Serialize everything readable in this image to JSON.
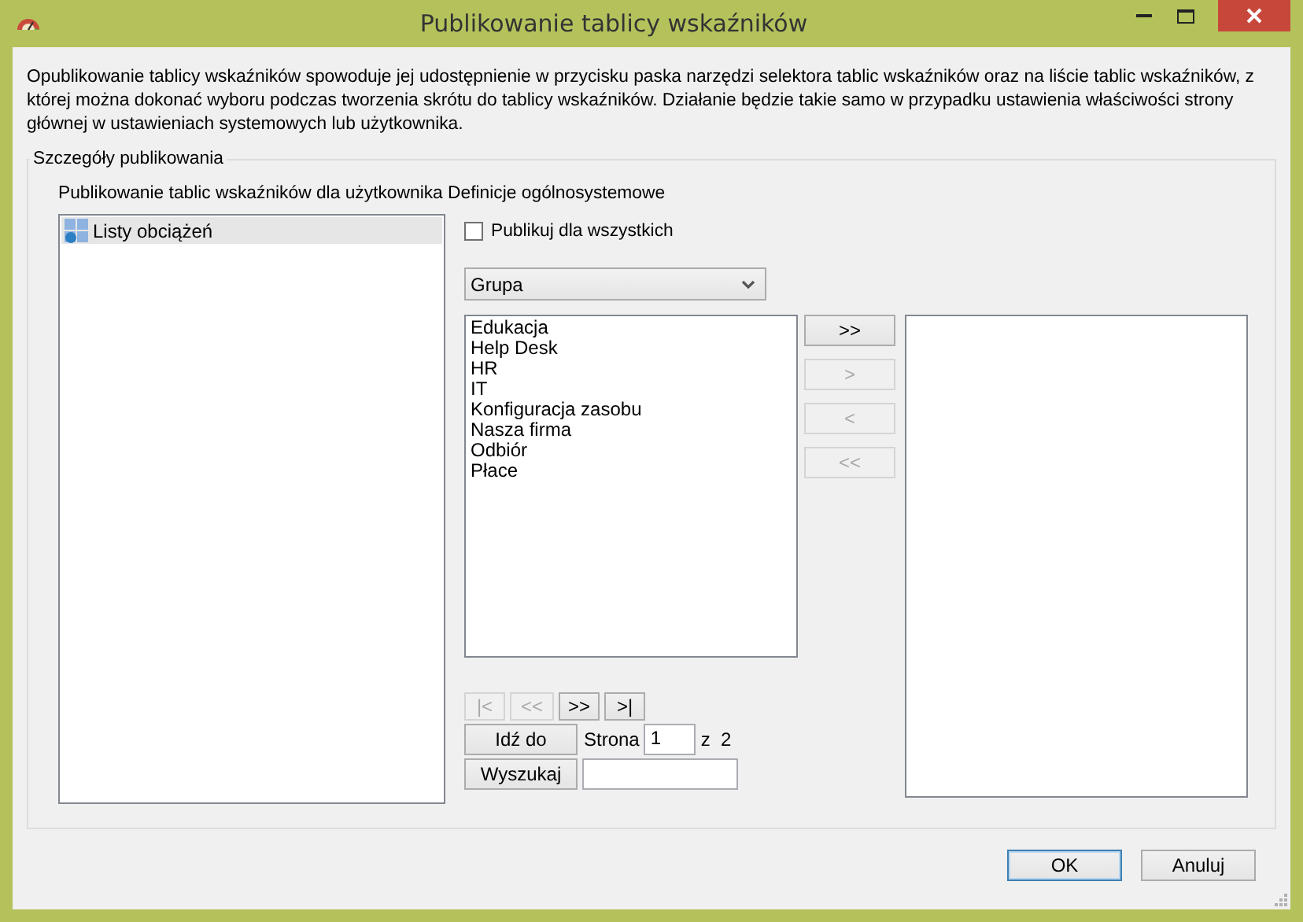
{
  "window": {
    "title": "Publikowanie tablicy wskaźników"
  },
  "description": "Opublikowanie tablicy wskaźników spowoduje jej udostępnienie w przycisku paska narzędzi selektora tablic wskaźników oraz na liście tablic wskaźników, z której można dokonać wyboru podczas tworzenia skrótu do tablicy wskaźników. Działanie będzie takie samo w przypadku ustawienia właściwości strony głównej w ustawieniach systemowych lub użytkownika.",
  "group": {
    "title": "Szczegóły publikowania",
    "subtitle": "Publikowanie tablic wskaźników dla użytkownika Definicje ogólnosystemowe"
  },
  "tree": [
    {
      "label": "Listy obciążeń",
      "selected": true
    }
  ],
  "publish_all": {
    "label": "Publikuj dla wszystkich",
    "checked": false
  },
  "dropdown": {
    "value": "Grupa"
  },
  "available": [
    "Edukacja",
    "Help Desk",
    "HR",
    "IT",
    "Konfiguracja zasobu",
    "Nasza firma",
    "Odbiór",
    "Płace"
  ],
  "transfer_buttons": [
    {
      "label": ">>",
      "disabled": false
    },
    {
      "label": ">",
      "disabled": true
    },
    {
      "label": "<",
      "disabled": true
    },
    {
      "label": "<<",
      "disabled": true
    }
  ],
  "pager_buttons": [
    {
      "label": "|<",
      "disabled": true
    },
    {
      "label": "<<",
      "disabled": true
    },
    {
      "label": ">>",
      "disabled": false
    },
    {
      "label": ">|",
      "disabled": false
    }
  ],
  "goto_button": "Idź do",
  "page_label": "Strona",
  "page_value": "1",
  "page_of": "z  2",
  "search_button": "Wyszukaj",
  "buttons": [
    {
      "label": "OK",
      "default": true
    },
    {
      "label": "Anuluj",
      "default": false
    }
  ]
}
